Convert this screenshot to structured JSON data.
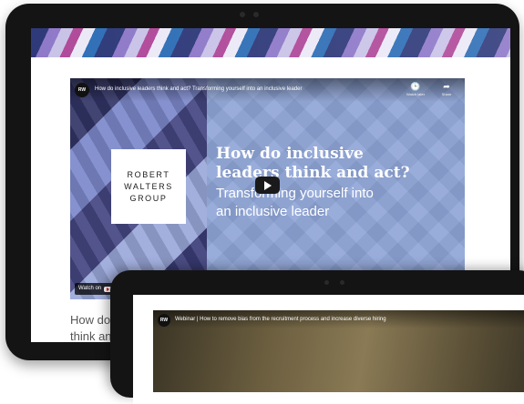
{
  "main_video": {
    "channel_logo": "RW",
    "title": "How do inclusive leaders think and act? Transforming yourself into an inclusive leader",
    "actions": [
      {
        "icon": "clock-icon",
        "glyph": "🕒",
        "label": "Watch later"
      },
      {
        "icon": "share-icon",
        "glyph": "➦",
        "label": "Share"
      }
    ],
    "brand_lines": [
      "ROBERT",
      "WALTERS",
      "GROUP"
    ],
    "headline_line1": "How do inclusive",
    "headline_line2": "leaders think and act?",
    "subtitle_line1": "Transforming yourself into",
    "subtitle_line2": "an inclusive leader",
    "watch_on": "Watch on"
  },
  "article": {
    "line1": "How do",
    "line2": "think an"
  },
  "second_video": {
    "channel_logo": "RW",
    "title": "Webinar | How to remove bias from the recruitment process and increase diverse hiring"
  },
  "colors": {
    "video_blue": "#8ea4d6",
    "tablet_frame": "#141414"
  }
}
